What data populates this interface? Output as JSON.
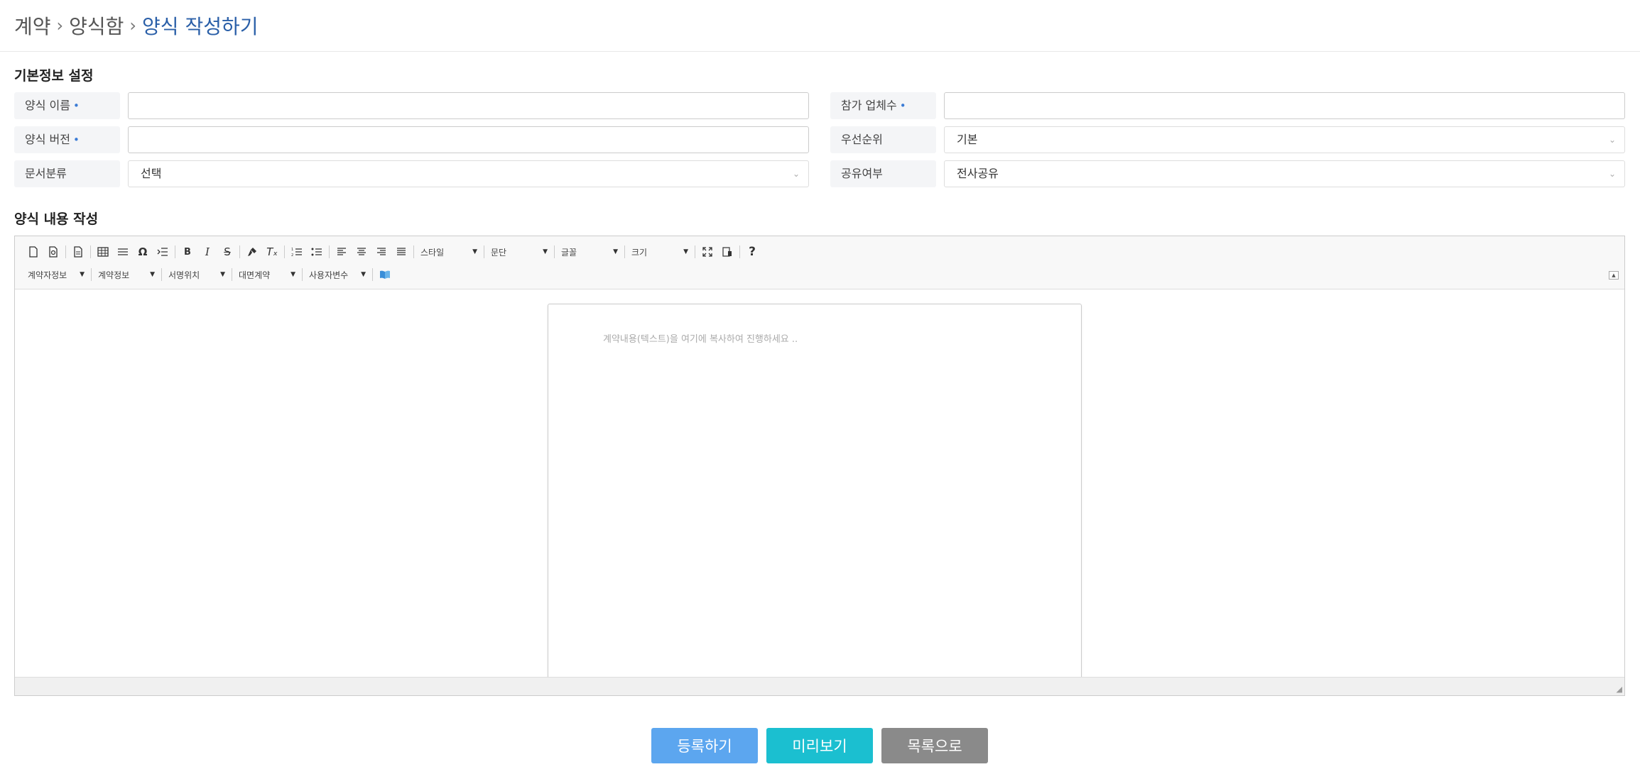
{
  "breadcrumb": {
    "items": [
      "계약",
      "양식함",
      "양식 작성하기"
    ],
    "separator": "›"
  },
  "basic_info": {
    "title": "기본정보 설정",
    "required_mark": "•",
    "fields": {
      "form_name": {
        "label": "양식 이름",
        "required": true,
        "value": ""
      },
      "form_version": {
        "label": "양식 버전",
        "required": true,
        "value": ""
      },
      "doc_category": {
        "label": "문서분류",
        "value": "선택"
      },
      "participants": {
        "label": "참가 업체수",
        "required": true,
        "value": ""
      },
      "priority": {
        "label": "우선순위",
        "value": "기본"
      },
      "sharing": {
        "label": "공유여부",
        "value": "전사공유"
      }
    }
  },
  "content": {
    "title": "양식 내용 작성",
    "placeholder": "계약내용(텍스트)을 여기에 복사하여 진행하세요 .."
  },
  "toolbar": {
    "combos": {
      "style": "스타일",
      "paragraph": "문단",
      "font": "글꼴",
      "size": "크기"
    },
    "row2": {
      "contractor": "계약자정보",
      "contract": "계약정보",
      "sign": "서명위치",
      "facetoface": "대면계약",
      "uservar": "사용자변수"
    },
    "glyphs": {
      "omega": "Ω",
      "bold": "B",
      "italic": "I",
      "strike": "S",
      "remove_format": "Tₓ",
      "help": "?"
    }
  },
  "actions": {
    "register": "등록하기",
    "preview": "미리보기",
    "list": "목록으로"
  },
  "colors": {
    "register": "#5ca6ef",
    "preview": "#1bbfd0",
    "list": "#8a8a8a",
    "accent": "#2a5fa8"
  }
}
